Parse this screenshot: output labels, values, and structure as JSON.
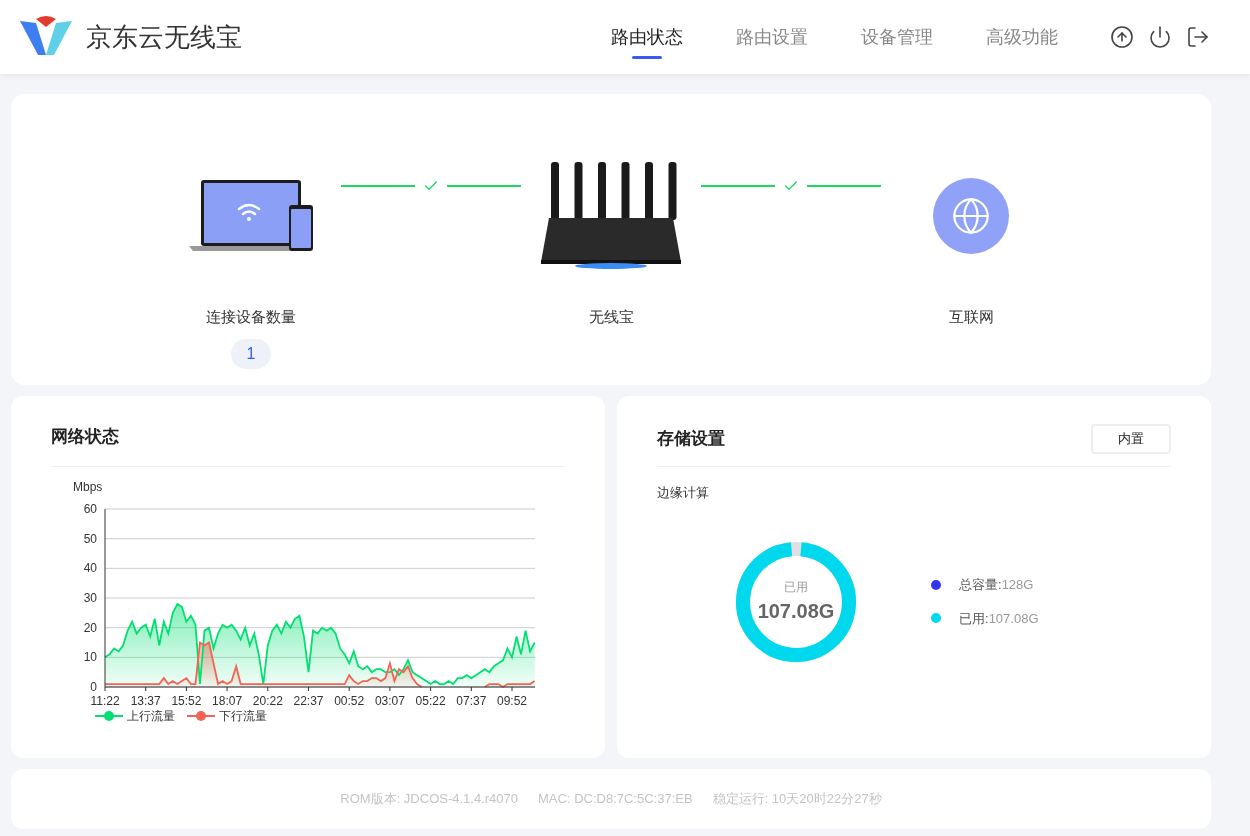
{
  "header": {
    "brand": "京东云无线宝",
    "tabs": [
      {
        "label": "路由状态",
        "selected": true
      },
      {
        "label": "路由设置",
        "selected": false
      },
      {
        "label": "设备管理",
        "selected": false
      },
      {
        "label": "高级功能",
        "selected": false
      }
    ]
  },
  "topology": {
    "nodes": [
      {
        "kind": "devices",
        "label": "连接设备数量",
        "count": "1"
      },
      {
        "kind": "router",
        "label": "无线宝"
      },
      {
        "kind": "internet",
        "label": "互联网"
      }
    ],
    "links": [
      {
        "connected": true
      },
      {
        "connected": true
      }
    ]
  },
  "network": {
    "title": "网络状态",
    "chart_data": {
      "type": "line",
      "grid": true,
      "ylabel": "Mbps",
      "ylim": [
        0,
        60
      ],
      "yticks": [
        0,
        10,
        20,
        30,
        40,
        50,
        60
      ],
      "categories": [
        "11:22",
        null,
        null,
        null,
        null,
        null,
        null,
        null,
        null,
        "13:37",
        null,
        null,
        null,
        null,
        null,
        null,
        null,
        null,
        "15:52",
        null,
        null,
        null,
        null,
        null,
        null,
        null,
        null,
        "18:07",
        null,
        null,
        null,
        null,
        null,
        null,
        null,
        null,
        "20:22",
        null,
        null,
        null,
        null,
        null,
        null,
        null,
        null,
        "22:37",
        null,
        null,
        null,
        null,
        null,
        null,
        null,
        null,
        "00:52",
        null,
        null,
        null,
        null,
        null,
        null,
        null,
        null,
        "03:07",
        null,
        null,
        null,
        null,
        null,
        null,
        null,
        null,
        "05:22",
        null,
        null,
        null,
        null,
        null,
        null,
        null,
        null,
        "07:37",
        null,
        null,
        null,
        null,
        null,
        null,
        null,
        null,
        "09:52",
        null,
        null,
        null,
        null,
        null
      ],
      "series": [
        {
          "name": "上行流量",
          "color": "#00e070",
          "values": [
            10,
            11,
            13,
            12,
            14,
            19,
            22,
            18,
            20,
            21,
            17,
            23,
            14,
            22,
            18,
            25,
            28,
            27,
            22,
            24,
            21,
            1,
            19,
            20,
            13,
            18,
            21,
            20,
            21,
            19,
            16,
            20,
            14,
            18,
            11,
            1,
            14,
            19,
            21,
            18,
            22,
            20,
            23,
            24,
            17,
            5,
            19,
            18,
            20,
            19,
            20,
            18,
            13,
            11,
            8,
            12,
            7,
            6,
            7,
            5,
            6,
            6,
            5,
            5,
            6,
            4,
            6,
            9,
            5,
            4,
            3,
            2,
            1,
            2,
            1,
            1,
            2,
            1,
            3,
            3,
            4,
            3,
            4,
            5,
            6,
            5,
            7,
            8,
            9,
            13,
            10,
            17,
            11,
            19,
            12,
            15
          ]
        },
        {
          "name": "下行流量",
          "color": "#f26455",
          "values": [
            1,
            1,
            1,
            1,
            1,
            1,
            1,
            1,
            1,
            1,
            1,
            1,
            1,
            3,
            1,
            2,
            1,
            2,
            3,
            1,
            1,
            15,
            14,
            15,
            8,
            1,
            2,
            1,
            2,
            7,
            1,
            1,
            1,
            1,
            1,
            1,
            1,
            1,
            1,
            1,
            1,
            1,
            1,
            1,
            1,
            1,
            1,
            1,
            1,
            1,
            1,
            1,
            1,
            1,
            4,
            2,
            1,
            2,
            2,
            3,
            3,
            2,
            3,
            8,
            2,
            6,
            5,
            7,
            3,
            1,
            0,
            null,
            null,
            null,
            null,
            null,
            null,
            null,
            null,
            null,
            null,
            null,
            null,
            null,
            0,
            1,
            1,
            1,
            0,
            1,
            1,
            1,
            1,
            1,
            1,
            2
          ]
        }
      ]
    }
  },
  "storage": {
    "title": "存储设置",
    "button": "内置",
    "subtitle": "边缘计算",
    "donut": {
      "caption": "已用",
      "value": "107.08G",
      "level": 0.97
    },
    "legend": [
      {
        "label": "总容量:",
        "value": "128G",
        "color": "#3535ee"
      },
      {
        "label": "已用:",
        "value": "107.08G",
        "color": "#00d8ee"
      }
    ]
  },
  "footer": [
    "ROM版本: JDCOS-4.1.4.r4070",
    "MAC: DC:D8:7C:5C:37:EB",
    "稳定运行: 10天20时22分27秒"
  ]
}
